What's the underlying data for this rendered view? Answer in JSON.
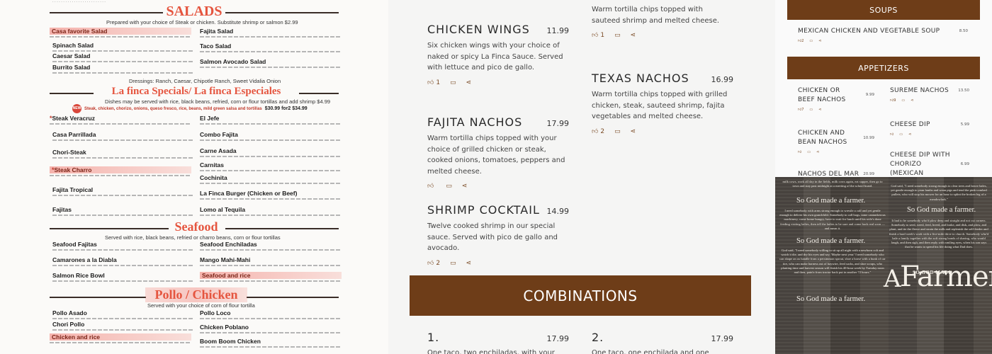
{
  "paper_menu": {
    "salads": {
      "title": "SALADS",
      "note": "Prepared with your choice of Steak or chicken. Substitute shrimp or salmon $2.99",
      "items_left": [
        "Casa favorite Salad",
        "Spinach Salad",
        "Caesar Salad",
        "Burrito Salad"
      ],
      "items_right": [
        "Fajita Salad",
        "Taco Salad",
        "Salmon Avocado Salad"
      ],
      "dressings": "Dressings: Ranch, Caesar, Chipotle Ranch, Sweet Vidalia Onion"
    },
    "specials": {
      "title": "La finca Specials/ La finca Especiales",
      "note": "Dishes may be served with rice, black beans, refried, corn or flour tortillas and add shrimp $4.99",
      "badge": "NEW",
      "promo": "Steak, chicken, chorizo, onions, queso fresco, rice, beans, mild green salsa and tortillas",
      "promo_prices": "$30.99   for2  $34.99",
      "items_left": [
        "Steak Veracruz",
        "Casa Parrillada",
        "Chori-Steak",
        "Steak Charro",
        "Fajita Tropical",
        "Fajitas"
      ],
      "items_right": [
        "El Jefe",
        "Combo Fajita",
        "Carne Asada",
        "Carnitas",
        "Cochinita",
        "La Finca Burger (Chicken or Beef)",
        "Lomo al Tequila"
      ]
    },
    "seafood": {
      "title": "Seafood",
      "note": "Served with rice, black beans, refried or charro beans, corn or flour tortillas",
      "items_left": [
        "Seafood Fajitas",
        "Camarones a la Diabla",
        "Salmon Rice Bowl"
      ],
      "items_right": [
        "Seafood Enchiladas",
        "Mango Mahi-Mahi",
        "Seafood and rice"
      ]
    },
    "chicken": {
      "title": "Pollo / Chicken",
      "note": "Served with your choice of corn of flour tortilla",
      "items_left": [
        "Pollo Asado",
        "Chori Pollo",
        "Chicken and rice"
      ],
      "items_right": [
        "Pollo Loco",
        "Chicken Poblano",
        "Boom Boom Chicken"
      ]
    }
  },
  "web_menu": {
    "items": [
      {
        "name": "",
        "price": "",
        "desc": "Warm tortilla chips topped with sauteed shrimp and melted cheese.",
        "likes": "1",
        "comments": ""
      },
      {
        "name": "CHICKEN WINGS",
        "price": "11.99",
        "desc": "Six chicken wings with your choice of naked or spicy La Finca Sauce. Served with lettuce and pico de gallo.",
        "likes": "1",
        "comments": ""
      },
      {
        "name": "TEXAS NACHOS",
        "price": "16.99",
        "desc": "Warm tortilla chips topped with grilled chicken, steak, sauteed shrimp, fajita vegetables and melted cheese.",
        "likes": "2",
        "comments": ""
      },
      {
        "name": "FAJITA NACHOS",
        "price": "17.99",
        "desc": "Warm tortilla chips topped with your choice of grilled chicken or steak, cooked onions, tomatoes, peppers and melted cheese.",
        "likes": "",
        "comments": ""
      },
      {
        "name": "SHRIMP COCKTAIL",
        "price": "14.99",
        "desc": "Twelve cooked shrimp in our special sauce. Served with pico de gallo and avocado.",
        "likes": "2",
        "comments": ""
      }
    ],
    "combinations_title": "COMBINATIONS",
    "combos": [
      {
        "name": "1.",
        "price": "17.99",
        "desc": "One taco, two enchiladas, with your choice"
      },
      {
        "name": "2.",
        "price": "17.99",
        "desc": "One taco, one enchilada and one chalupa."
      }
    ]
  },
  "small_menu": {
    "soups_title": "SOUPS",
    "soup": {
      "name": "MEXICAN CHICKEN AND VEGETABLE SOUP",
      "price": "8.50",
      "likes": "2"
    },
    "appetizers_title": "APPETIZERS",
    "appetizers": [
      {
        "name": "CHICKEN OR BEEF NACHOS",
        "price": "9.99",
        "likes": "7"
      },
      {
        "name": "SUREME NACHOS",
        "price": "13.50",
        "likes": "9"
      },
      {
        "name": "CHICKEN AND BEAN NACHOS",
        "price": "10.99",
        "likes": ""
      },
      {
        "name": "CHEESE DIP",
        "price": "5.99",
        "likes": ""
      },
      {
        "name": "CHEESE DIP WITH CHORIZO (MEXICAN SAUSAGE)",
        "price": "6.99",
        "likes": ""
      },
      {
        "name": "NACHOS DEL MAR",
        "price": "20.99",
        "likes": ""
      }
    ]
  },
  "plaque": {
    "refrain": "So God made a farmer.",
    "so_god_made": "SO GOD MADE",
    "a_word": "A",
    "farmer_word": "Farmer.",
    "verse_top_left": "milk cows, work all day in the fields, milk cows again, eat supper, then go to town and stay past midnight at a meeting of the school board.",
    "verse_mid_left": "I need somebody with arms strong enough to wrestle a calf and yet gentle enough to deliver his own grandchild. Somebody to call hogs, tame cantankerous machinery, come home hungry, have to wait for lunch until his wife's done feeding visiting ladies, then tell the ladies to be sure and come back real soon — and mean it.",
    "verse_bot_left": "God said, \"I need somebody willing to sit up all night with a newborn colt and watch it die, and dry his eyes and say, 'Maybe next year.' I need somebody who can shape an ax handle from a persimmon sprout, shoe a horse with a hunk of car tire, who can make harness out of haywire, feed sacks, and shoe scraps, who planting time and harvest season will finish his 40-hour week by Tuesday noon and then, pain'n from tractor back put in another 72 hours.\"",
    "verse_top_right": "God said, \"I need somebody strong enough to clear trees and heave bales, yet gentle enough to yean lambs and wean pigs and tend the pink-combed pullets, who will stop his mower for an hour to splint the broken leg of a meadowlark.\"",
    "verse_mid_right": "It had to be somebody who'd plow deep and straight and not cut corners. Somebody to seed, weed, feed, breed, and brake, and disk, and plow, and plant, and tie the fleece and strain the milk and replenish the self-feeder and finish a hard week's work with a five-mile drive to church. Somebody who'd bale a family together with the soft strong bonds of sharing, who would laugh, and then sigh, and then reply with smiling eyes, when his son says that he wants to spend his life doing what Dad does."
  },
  "colors": {
    "banner_brown": "#6e3d18",
    "salad_red": "#e5553f",
    "highlight_pink": "#f07a6e"
  },
  "icons": [
    "thumbs-up-icon",
    "comment-icon",
    "share-icon"
  ]
}
